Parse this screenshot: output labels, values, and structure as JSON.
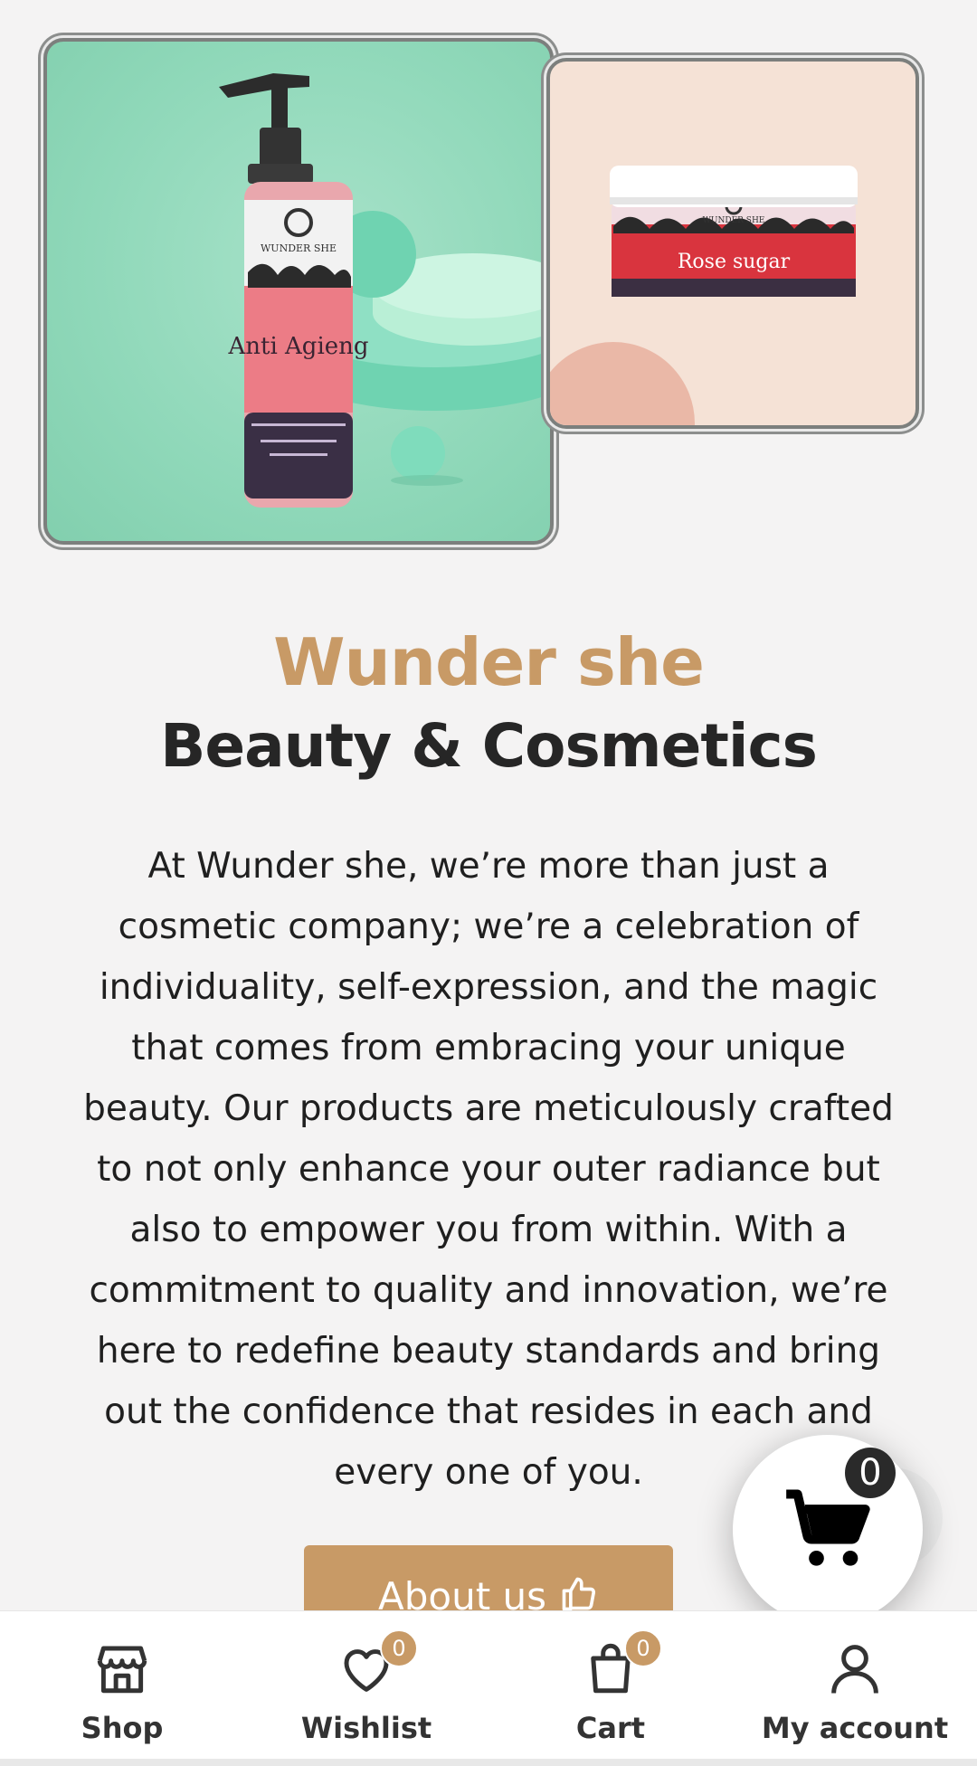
{
  "hero": {
    "left_product_alt": "Anti Agieng face wash bottle",
    "left_product_brand": "WUNDER SHE",
    "left_product_name": "Anti Agieng",
    "right_product_brand": "WUNDER SHE",
    "right_product_name": "Rose sugar"
  },
  "heading": {
    "brand": "Wunder she",
    "tagline": "Beauty & Cosmetics"
  },
  "intro": {
    "text": "At Wunder she, we’re more than just a cosmetic company; we’re a celebration of individuality, self-expression, and the magic that comes from embracing your unique beauty. Our products are meticulously crafted to not only enhance your outer radiance but also to empower you from within. With a commitment to quality and innovation, we’re here to redefine beauty standards and bring out the confidence that resides in each and every one of you."
  },
  "about_button": {
    "label": "About us",
    "icon": "thumbs-up-icon"
  },
  "floating_cart": {
    "count": "0",
    "icon": "shopping-cart-icon"
  },
  "bottom_nav": {
    "items": [
      {
        "label": "Shop",
        "icon": "store-icon"
      },
      {
        "label": "Wishlist",
        "icon": "heart-icon",
        "badge": "0"
      },
      {
        "label": "Cart",
        "icon": "shopping-bag-icon",
        "badge": "0"
      },
      {
        "label": "My account",
        "icon": "user-icon"
      }
    ]
  },
  "colors": {
    "accent": "#c89a66",
    "background": "#f4f3f3",
    "text": "#222222"
  }
}
